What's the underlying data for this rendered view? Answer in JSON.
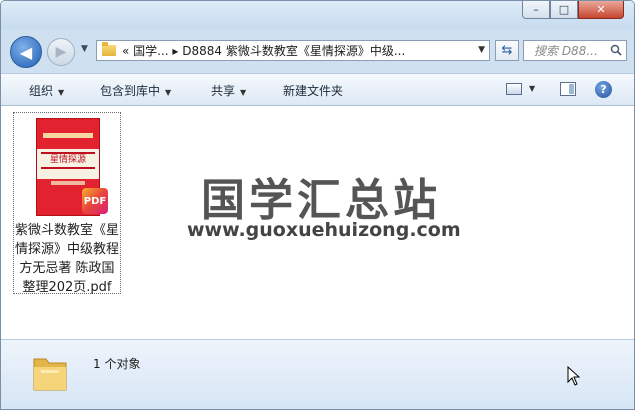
{
  "window": {
    "caption": {
      "minimize": "–",
      "maximize": "□",
      "close": "✕"
    }
  },
  "nav": {
    "back_icon": "arrow-left-icon",
    "forward_icon": "arrow-right-icon",
    "address_path": "«  国学...  ▸  D8884 紫微斗数教室《星情探源》中级...",
    "search_placeholder": "搜索 D88..."
  },
  "toolbar": {
    "organize": "组织",
    "include_library": "包含到库中",
    "share": "共享",
    "new_folder": "新建文件夹"
  },
  "content": {
    "file": {
      "name": "紫微斗数教室《星情探源》中级教程方无忌著 陈政国整理202页.pdf",
      "thumb_title": "星情探源",
      "badge": "PDF"
    },
    "watermark_cn": "国学汇总站",
    "watermark_en": "www.guoxuehuizong.com"
  },
  "status": {
    "count_text": "1 个对象"
  },
  "colors": {
    "accent": "#1f5fb5",
    "close_button": "#c7462f",
    "cover_red": "#e2222f"
  }
}
